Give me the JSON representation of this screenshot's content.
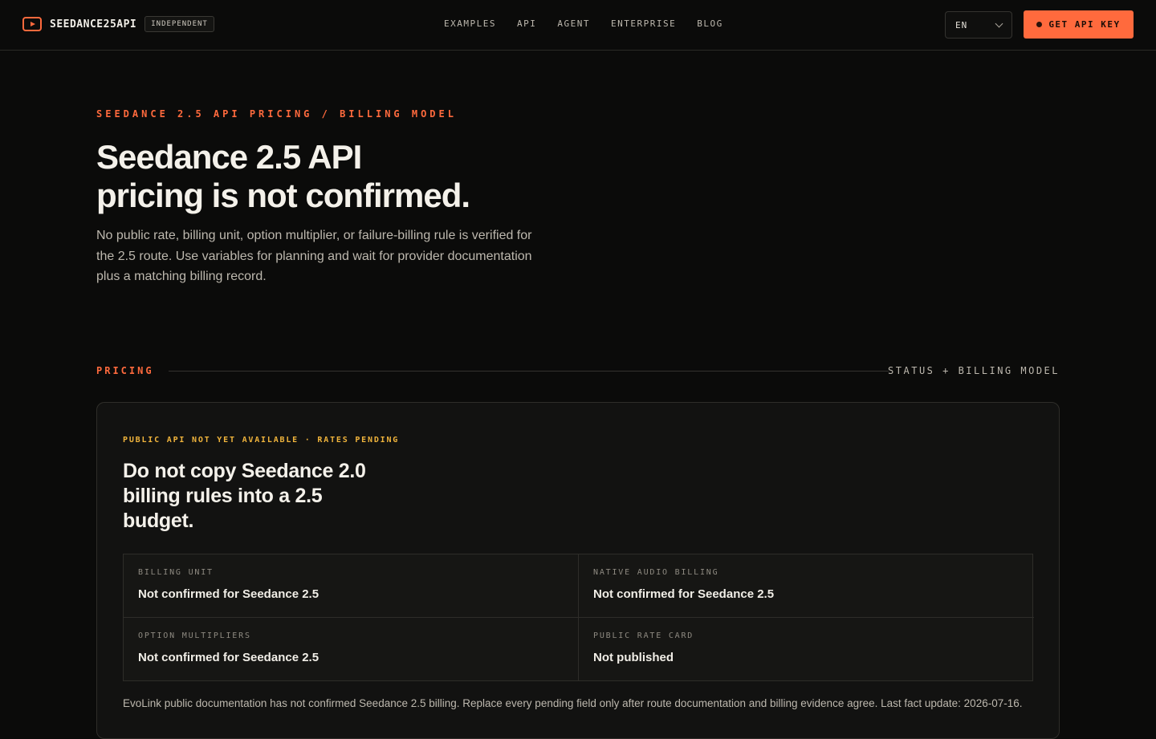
{
  "header": {
    "brand_name": "SEEDANCE25API",
    "brand_badge": "INDEPENDENT",
    "nav": [
      "EXAMPLES",
      "API",
      "AGENT",
      "ENTERPRISE",
      "BLOG"
    ],
    "language": "EN",
    "cta_label": "GET API KEY"
  },
  "hero": {
    "eyebrow": "SEEDANCE 2.5 API PRICING / BILLING MODEL",
    "title_line1": "Seedance 2.5 API",
    "title_line2": "pricing is not confirmed.",
    "subtitle": "No public rate, billing unit, option multiplier, or failure-billing rule is verified for the 2.5 route. Use variables for planning and wait for provider documentation plus a matching billing record."
  },
  "section": {
    "label": "PRICING",
    "right_label": "STATUS + BILLING MODEL"
  },
  "card": {
    "status": "PUBLIC API NOT YET AVAILABLE · RATES PENDING",
    "title": "Do not copy Seedance 2.0 billing rules into a 2.5 budget.",
    "cells": [
      {
        "label": "BILLING UNIT",
        "value": "Not confirmed for Seedance 2.5"
      },
      {
        "label": "NATIVE AUDIO BILLING",
        "value": "Not confirmed for Seedance 2.5"
      },
      {
        "label": "OPTION MULTIPLIERS",
        "value": "Not confirmed for Seedance 2.5"
      },
      {
        "label": "PUBLIC RATE CARD",
        "value": "Not published"
      }
    ],
    "note": "EvoLink public documentation has not confirmed Seedance 2.5 billing. Replace every pending field only after route documentation and billing evidence agree. Last fact update: 2026-07-16."
  },
  "colors": {
    "accent": "#ff6a3d",
    "status": "#f0b43c",
    "background": "#0b0b0a"
  },
  "icons": {
    "brand": "play-icon",
    "language": "chevron-down-icon"
  }
}
